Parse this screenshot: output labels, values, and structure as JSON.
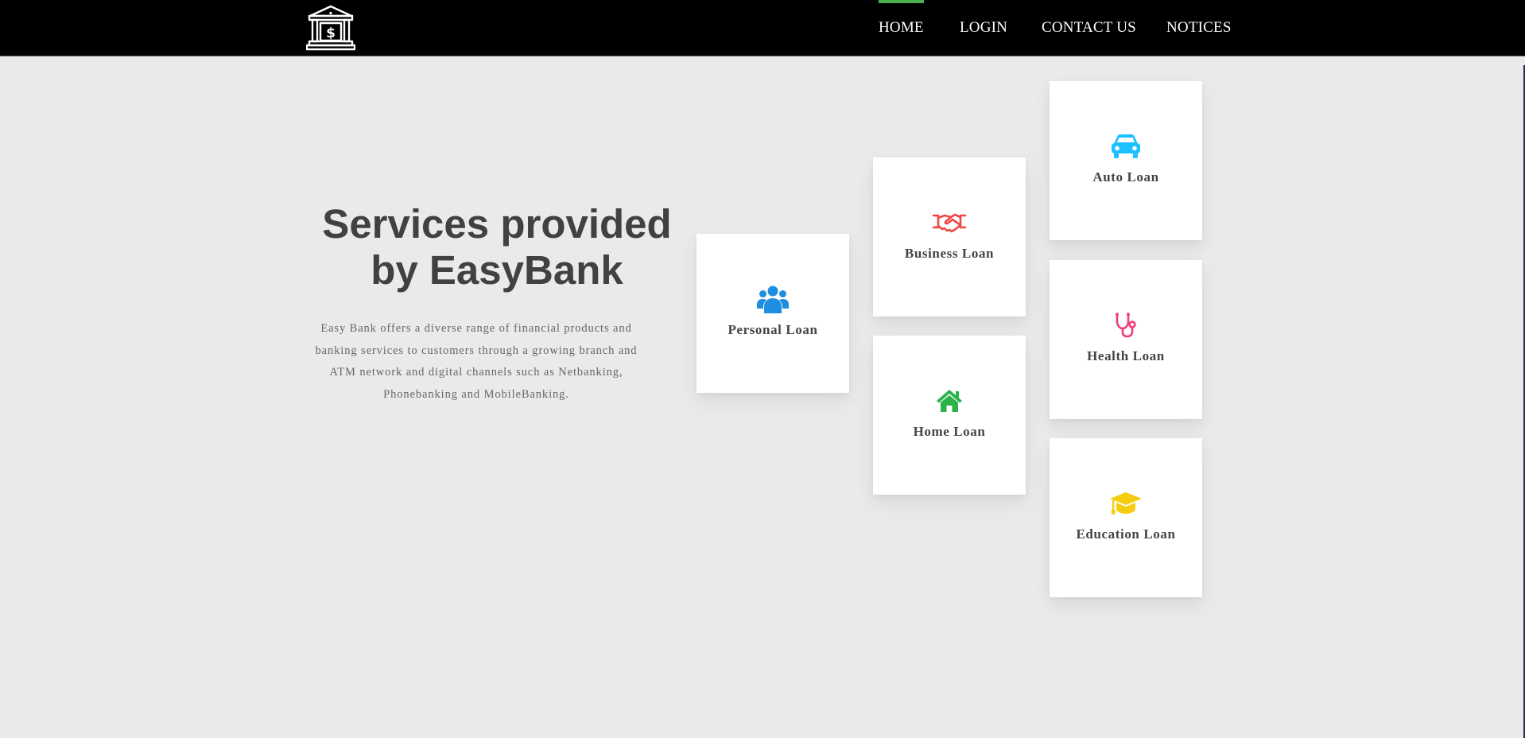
{
  "nav": {
    "logo_icon": "bank-dollar-icon",
    "items": [
      {
        "label": "HOME",
        "active": true
      },
      {
        "label": "LOGIN",
        "active": false
      },
      {
        "label": "CONTACT US",
        "active": false
      },
      {
        "label": "NOTICES",
        "active": false
      }
    ],
    "active_color": "#4caf50"
  },
  "hero": {
    "title": "Services provided by EasyBank",
    "description": "Easy Bank offers a diverse range of financial products and banking services to customers through a growing branch and ATM network and digital channels such as Netbanking, Phonebanking and MobileBanking."
  },
  "services": [
    {
      "label": "Personal Loan",
      "icon": "users-icon",
      "color": "#1e8fe0"
    },
    {
      "label": "Business Loan",
      "icon": "handshake-icon",
      "color": "#ef4646"
    },
    {
      "label": "Home Loan",
      "icon": "home-icon",
      "color": "#2cb24a"
    },
    {
      "label": "Auto Loan",
      "icon": "car-icon",
      "color": "#1ec1ff"
    },
    {
      "label": "Health Loan",
      "icon": "stethoscope-icon",
      "color": "#ee3e7b"
    },
    {
      "label": "Education Loan",
      "icon": "graduation-cap-icon",
      "color": "#f6cc12"
    }
  ]
}
